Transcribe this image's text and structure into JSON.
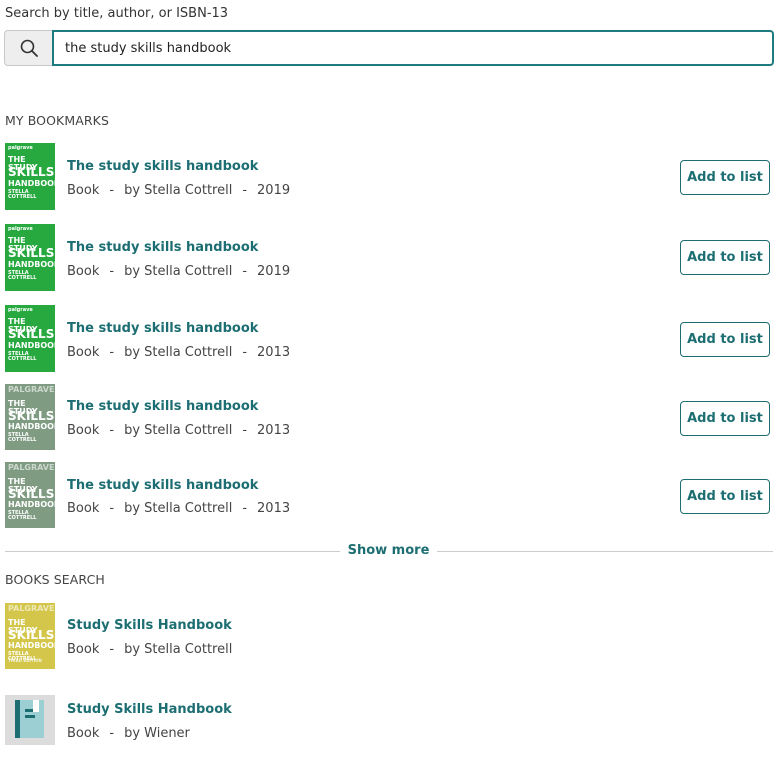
{
  "search": {
    "label": "Search by title, author, or ISBN-13",
    "value": "the study skills handbook",
    "icon": "search-icon"
  },
  "bookmarks": {
    "title": "MY BOOKMARKS",
    "add_label": "Add to list",
    "items": [
      {
        "title": "The study skills handbook",
        "type": "Book",
        "author": "by Stella Cottrell",
        "year": "2019",
        "cover": "green"
      },
      {
        "title": "The study skills handbook",
        "type": "Book",
        "author": "by Stella Cottrell",
        "year": "2019",
        "cover": "green"
      },
      {
        "title": "The study skills handbook",
        "type": "Book",
        "author": "by Stella Cottrell",
        "year": "2013",
        "cover": "green"
      },
      {
        "title": "The study skills handbook",
        "type": "Book",
        "author": "by Stella Cottrell",
        "year": "2013",
        "cover": "grey"
      },
      {
        "title": "The study skills handbook",
        "type": "Book",
        "author": "by Stella Cottrell",
        "year": "2013",
        "cover": "grey"
      }
    ],
    "show_more": "Show more"
  },
  "books_search": {
    "title": "BOOKS SEARCH",
    "items": [
      {
        "title": "Study Skills Handbook",
        "type": "Book",
        "author": "by Stella Cottrell",
        "cover": "yellow"
      },
      {
        "title": "Study Skills Handbook",
        "type": "Book",
        "author": "by Wiener",
        "cover": "generic"
      }
    ]
  },
  "colors": {
    "accent": "#1d6e72",
    "cover_green": "#27a93f",
    "cover_grey": "#7f9c82",
    "cover_yellow": "#d4c64b"
  }
}
